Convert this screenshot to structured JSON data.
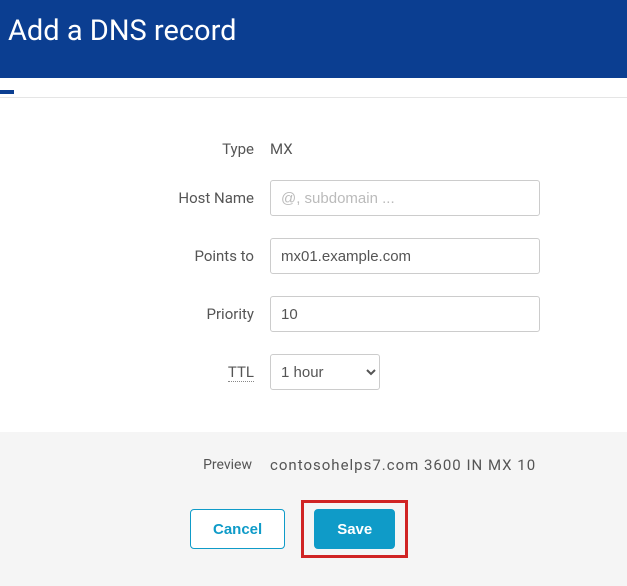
{
  "header": {
    "title": "Add a DNS record"
  },
  "form": {
    "type": {
      "label": "Type",
      "value": "MX"
    },
    "hostName": {
      "label": "Host Name",
      "placeholder": "@, subdomain ...",
      "value": ""
    },
    "pointsTo": {
      "label": "Points to",
      "value": "mx01.example.com"
    },
    "priority": {
      "label": "Priority",
      "value": "10"
    },
    "ttl": {
      "label": "TTL",
      "value": "1 hour"
    }
  },
  "preview": {
    "label": "Preview",
    "value": "contosohelps7.com  3600  IN  MX  10"
  },
  "buttons": {
    "cancel": "Cancel",
    "save": "Save"
  }
}
